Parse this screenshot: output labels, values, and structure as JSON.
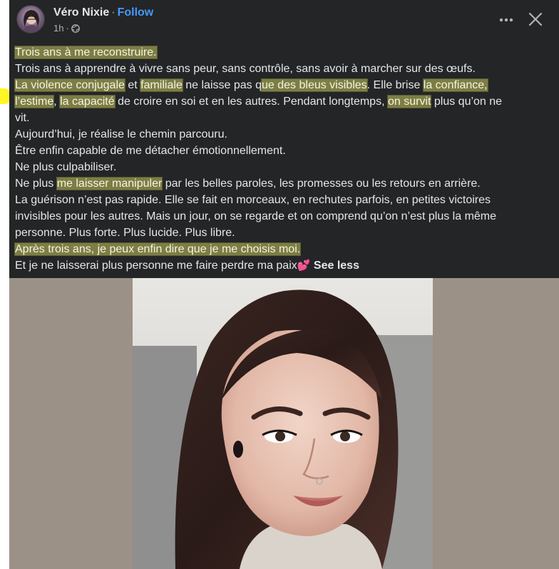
{
  "post": {
    "author": "Véro Nixie",
    "separator": "·",
    "follow_label": "Follow",
    "time": "1h",
    "meta_separator": "·",
    "privacy_icon": "globe-icon",
    "more_icon": "more-horizontal-icon",
    "close_icon": "close-icon"
  },
  "body": {
    "lines": [
      [
        {
          "t": "Trois ans à me reconstruire.",
          "h": true
        }
      ],
      [
        {
          "t": "Trois ans à apprendre à vivre sans peur, sans contrôle, sans avoir à marcher sur des œufs.",
          "h": false
        }
      ],
      [
        {
          "t": "La violence conjugale",
          "h": true
        },
        {
          "t": " et ",
          "h": false
        },
        {
          "t": "familiale",
          "h": true
        },
        {
          "t": " ne laisse pas q",
          "h": false
        },
        {
          "t": "ue des bleus visibles",
          "h": true
        },
        {
          "t": ". Elle brise ",
          "h": false
        },
        {
          "t": "la confiance,",
          "h": true
        }
      ],
      [
        {
          "t": "l’estime",
          "h": true
        },
        {
          "t": ", ",
          "h": false
        },
        {
          "t": "la capacité",
          "h": true
        },
        {
          "t": " de croire en soi et en les autres. Pendant longtemps, ",
          "h": false
        },
        {
          "t": "on survit",
          "h": true
        },
        {
          "t": " plus qu’on ne",
          "h": false
        }
      ],
      [
        {
          "t": "vit.",
          "h": false
        }
      ],
      [
        {
          "t": "Aujourd’hui, je réalise le chemin parcouru.",
          "h": false
        }
      ],
      [
        {
          "t": "Être enfin capable de me détacher émotionnellement.",
          "h": false
        }
      ],
      [
        {
          "t": "Ne plus culpabiliser.",
          "h": false
        }
      ],
      [
        {
          "t": "Ne plus ",
          "h": false
        },
        {
          "t": "me laisser manipuler",
          "h": true
        },
        {
          "t": " par les belles paroles, les promesses ou les retours en arrière.",
          "h": false
        }
      ],
      [
        {
          "t": "La guérison n’est pas rapide. Elle se fait en morceaux, en rechutes parfois, en petites victoires",
          "h": false
        }
      ],
      [
        {
          "t": "invisibles pour les autres. Mais un jour, on se regarde et on comprend qu’on n’est plus la même",
          "h": false
        }
      ],
      [
        {
          "t": "personne. Plus forte. Plus lucide. Plus libre.",
          "h": false
        }
      ],
      [
        {
          "t": "Après trois ans, je peux enfin dire que je me choisis moi.",
          "h": true
        }
      ]
    ],
    "last_line": "Et je ne laisserai plus personne me faire perdre ma paix",
    "heart": "💕",
    "see_less": "See less"
  },
  "colors": {
    "background": "#242526",
    "text": "#e4e6eb",
    "secondary": "#b0b3b8",
    "link": "#4599ff",
    "highlight": "#fafa6e"
  },
  "photo": {
    "description_icon": "portrait-photo"
  }
}
